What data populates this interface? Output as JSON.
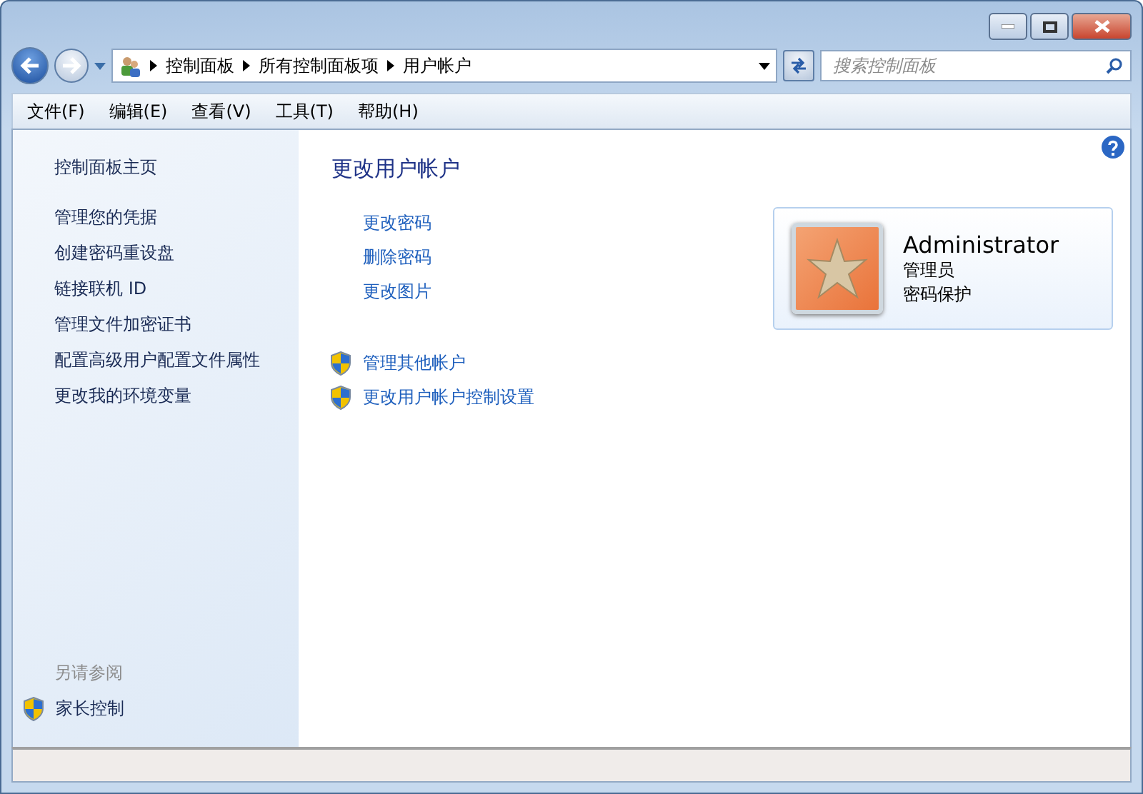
{
  "address_bar": {
    "crumbs": [
      "控制面板",
      "所有控制面板项",
      "用户帐户"
    ]
  },
  "search": {
    "placeholder": "搜索控制面板"
  },
  "menu": [
    "文件(F)",
    "编辑(E)",
    "查看(V)",
    "工具(T)",
    "帮助(H)"
  ],
  "sidebar": {
    "home": "控制面板主页",
    "links": [
      "管理您的凭据",
      "创建密码重设盘",
      "链接联机 ID",
      "管理文件加密证书",
      "配置高级用户配置文件属性",
      "更改我的环境变量"
    ],
    "see_also_title": "另请参阅",
    "see_also": [
      {
        "label": "家长控制",
        "kind": "shield"
      }
    ]
  },
  "main": {
    "title": "更改用户帐户",
    "tasks": [
      {
        "label": "更改密码",
        "kind": "plain"
      },
      {
        "label": "删除密码",
        "kind": "plain"
      },
      {
        "label": "更改图片",
        "kind": "plain"
      }
    ],
    "other_tasks": [
      {
        "label": "管理其他帐户",
        "kind": "shield"
      },
      {
        "label": "更改用户帐户控制设置",
        "kind": "shield"
      }
    ],
    "account": {
      "name": "Administrator",
      "role": "管理员",
      "status": "密码保护"
    }
  }
}
